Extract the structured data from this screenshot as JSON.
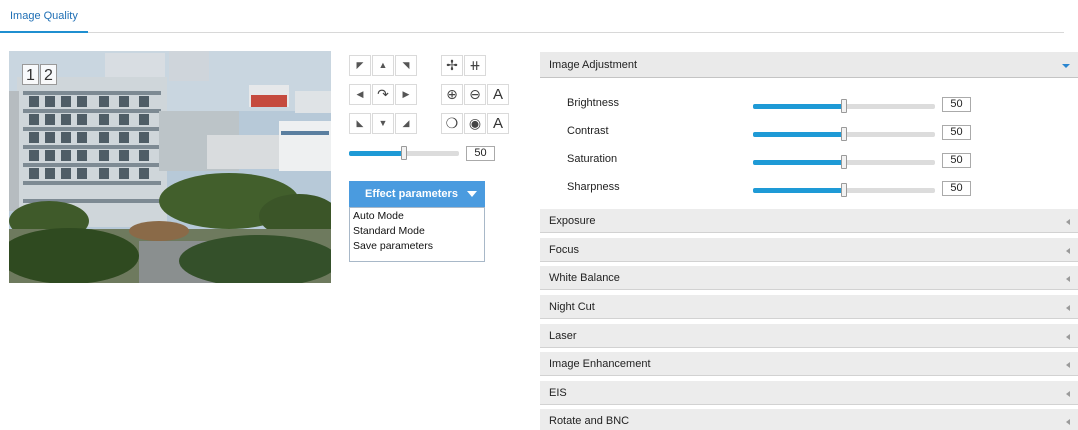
{
  "tabs": {
    "active_label": "Image Quality"
  },
  "video": {
    "channels": [
      "1",
      "2"
    ]
  },
  "ptz": {
    "icons": [
      "arrow-up-left-icon",
      "arrow-up-icon",
      "arrow-up-right-icon",
      "arrow-left-icon",
      "rotate-icon",
      "arrow-right-icon",
      "arrow-down-left-icon",
      "arrow-down-icon",
      "arrow-down-right-icon",
      "wiper-icon",
      "light-icon",
      "zoom-in-icon",
      "zoom-out-icon",
      "focus-a-icon",
      "iris-open-icon",
      "iris-close-icon",
      "iris-a-icon"
    ],
    "focus_a": "A",
    "iris_a": "A",
    "speed": {
      "value": "50",
      "fraction": 0.5
    }
  },
  "effect": {
    "button_label": "Effect parameters",
    "menu": [
      "Auto Mode",
      "Standard Mode",
      "Save parameters"
    ]
  },
  "image_adjustment": {
    "title": "Image Adjustment",
    "params": [
      {
        "label": "Brightness",
        "value": "50",
        "fraction": 0.5
      },
      {
        "label": "Contrast",
        "value": "50",
        "fraction": 0.5
      },
      {
        "label": "Saturation",
        "value": "50",
        "fraction": 0.5
      },
      {
        "label": "Sharpness",
        "value": "50",
        "fraction": 0.5
      }
    ]
  },
  "sections": [
    "Exposure",
    "Focus",
    "White Balance",
    "Night Cut",
    "Laser",
    "Image Enhancement",
    "EIS",
    "Rotate and BNC"
  ],
  "colors": {
    "accent": "#1e9ad6",
    "button": "#4a9bdf",
    "section_bg": "#ececec"
  }
}
